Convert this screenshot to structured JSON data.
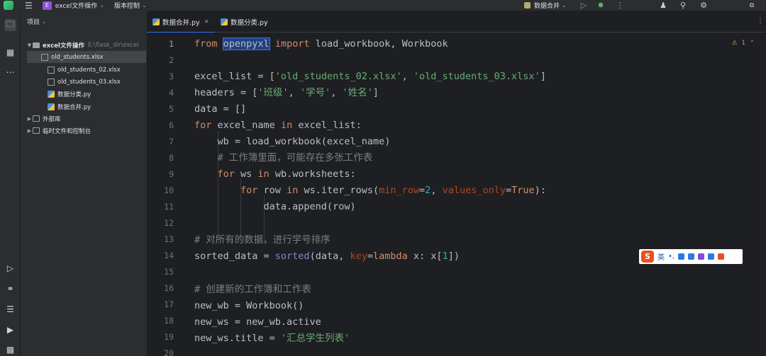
{
  "titlebar": {
    "project_badge": "E",
    "project_name": "excel文件操作",
    "vcs_label": "版本控制",
    "run_config": "数据合并"
  },
  "project_panel": {
    "header": "项目",
    "root_name": "excel文件操作",
    "root_path": "E:\\flask_dir\\excel",
    "files": [
      "old_students.xlsx",
      "old_students_02.xlsx",
      "old_students_03.xlsx",
      "数据分类.py",
      "数据合并.py"
    ],
    "external_libs": "外部库",
    "scratches": "临时文件和控制台"
  },
  "tabs": [
    {
      "label": "数据合并.py",
      "active": true
    },
    {
      "label": "数据分类.py",
      "active": false
    }
  ],
  "editor": {
    "inspection_count": "1",
    "line_numbers": [
      "1",
      "2",
      "3",
      "4",
      "5",
      "6",
      "7",
      "8",
      "9",
      "10",
      "11",
      "12",
      "13",
      "14",
      "15",
      "16",
      "17",
      "18",
      "19",
      "20"
    ]
  },
  "ime": {
    "lang": "英"
  },
  "colors": {
    "accent": "#3574f0",
    "keyword": "#cf8e6d",
    "string": "#6aab73",
    "comment": "#7a7e85",
    "number": "#2aacb8"
  }
}
